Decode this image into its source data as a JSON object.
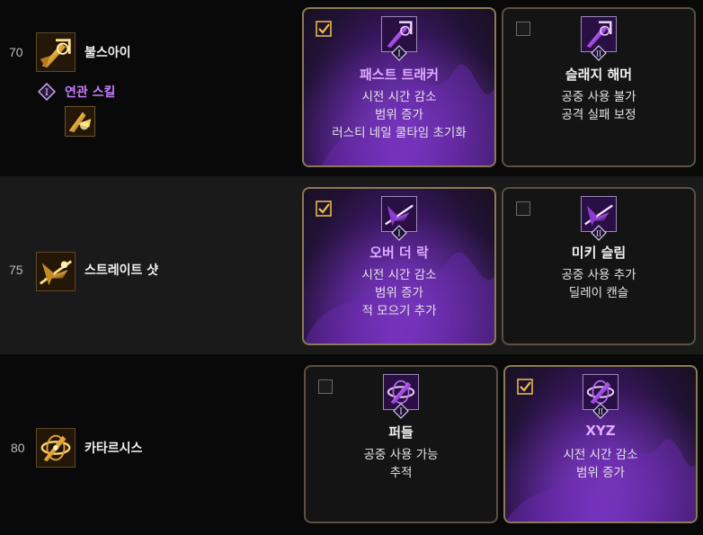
{
  "rows": [
    {
      "level": "70",
      "skill_name": "불스아이",
      "related": {
        "label": "연관 스킬",
        "badge": "I"
      },
      "options": [
        {
          "roman": "I",
          "title": "패스트 트래커",
          "selected": true,
          "lines": [
            "시전 시간 감소",
            "범위 증가",
            "러스티 네일 쿨타임 초기화"
          ]
        },
        {
          "roman": "II",
          "title": "슬래지 해머",
          "selected": false,
          "lines": [
            "공중 사용 불가",
            "공격 실패 보정"
          ]
        }
      ]
    },
    {
      "level": "75",
      "skill_name": "스트레이트 샷",
      "options": [
        {
          "roman": "I",
          "title": "오버 더 락",
          "selected": true,
          "lines": [
            "시전 시간 감소",
            "범위 증가",
            "적 모으기 추가"
          ]
        },
        {
          "roman": "II",
          "title": "미키 슬림",
          "selected": false,
          "lines": [
            "공중 사용 추가",
            "딜레이 캔슬"
          ]
        }
      ]
    },
    {
      "level": "80",
      "skill_name": "카타르시스",
      "options": [
        {
          "roman": "I",
          "title": "퍼들",
          "selected": false,
          "lines": [
            "공중 사용 가능",
            "추적"
          ]
        },
        {
          "roman": "II",
          "title": "XYZ",
          "selected": true,
          "lines": [
            "시전 시간 감소",
            "범위 증가"
          ]
        }
      ]
    }
  ],
  "colors": {
    "accent_purple": "#c77bff",
    "selected_title": "#e0a9ff",
    "checkbox_gold": "#f2c14a",
    "card_border": "#5a5045"
  },
  "icons": {
    "check": "checkmark-icon",
    "skill": "skill-icon",
    "roman_badge": "roman-numeral-badge-icon"
  }
}
